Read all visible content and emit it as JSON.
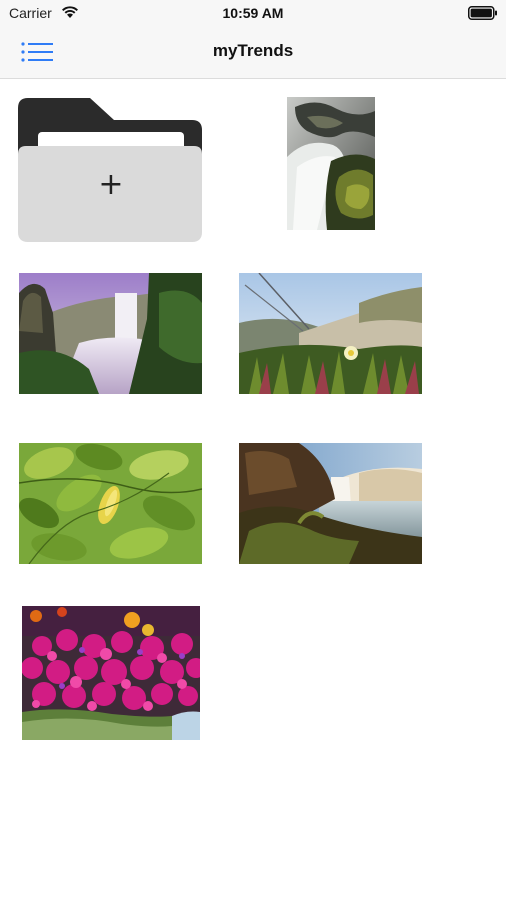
{
  "status_bar": {
    "carrier": "Carrier",
    "time": "10:59 AM",
    "wifi_icon": "wifi-icon",
    "battery_icon": "battery-icon"
  },
  "nav": {
    "title": "myTrends",
    "menu_icon": "list-menu-icon",
    "accent_color": "#2f7cf6"
  },
  "grid": {
    "add_tile": {
      "icon": "plus-icon",
      "folder_icon": "folder-icon",
      "plus_glyph": "+"
    },
    "photos": [
      {
        "subject": "waterfall-rocks-moss"
      },
      {
        "subject": "waterfall-cliff-mist"
      },
      {
        "subject": "yellow-flower-meadow"
      },
      {
        "subject": "green-leaves-yellow-flower"
      },
      {
        "subject": "river-falls-rocks"
      },
      {
        "subject": "pink-flowers-basket"
      }
    ]
  }
}
